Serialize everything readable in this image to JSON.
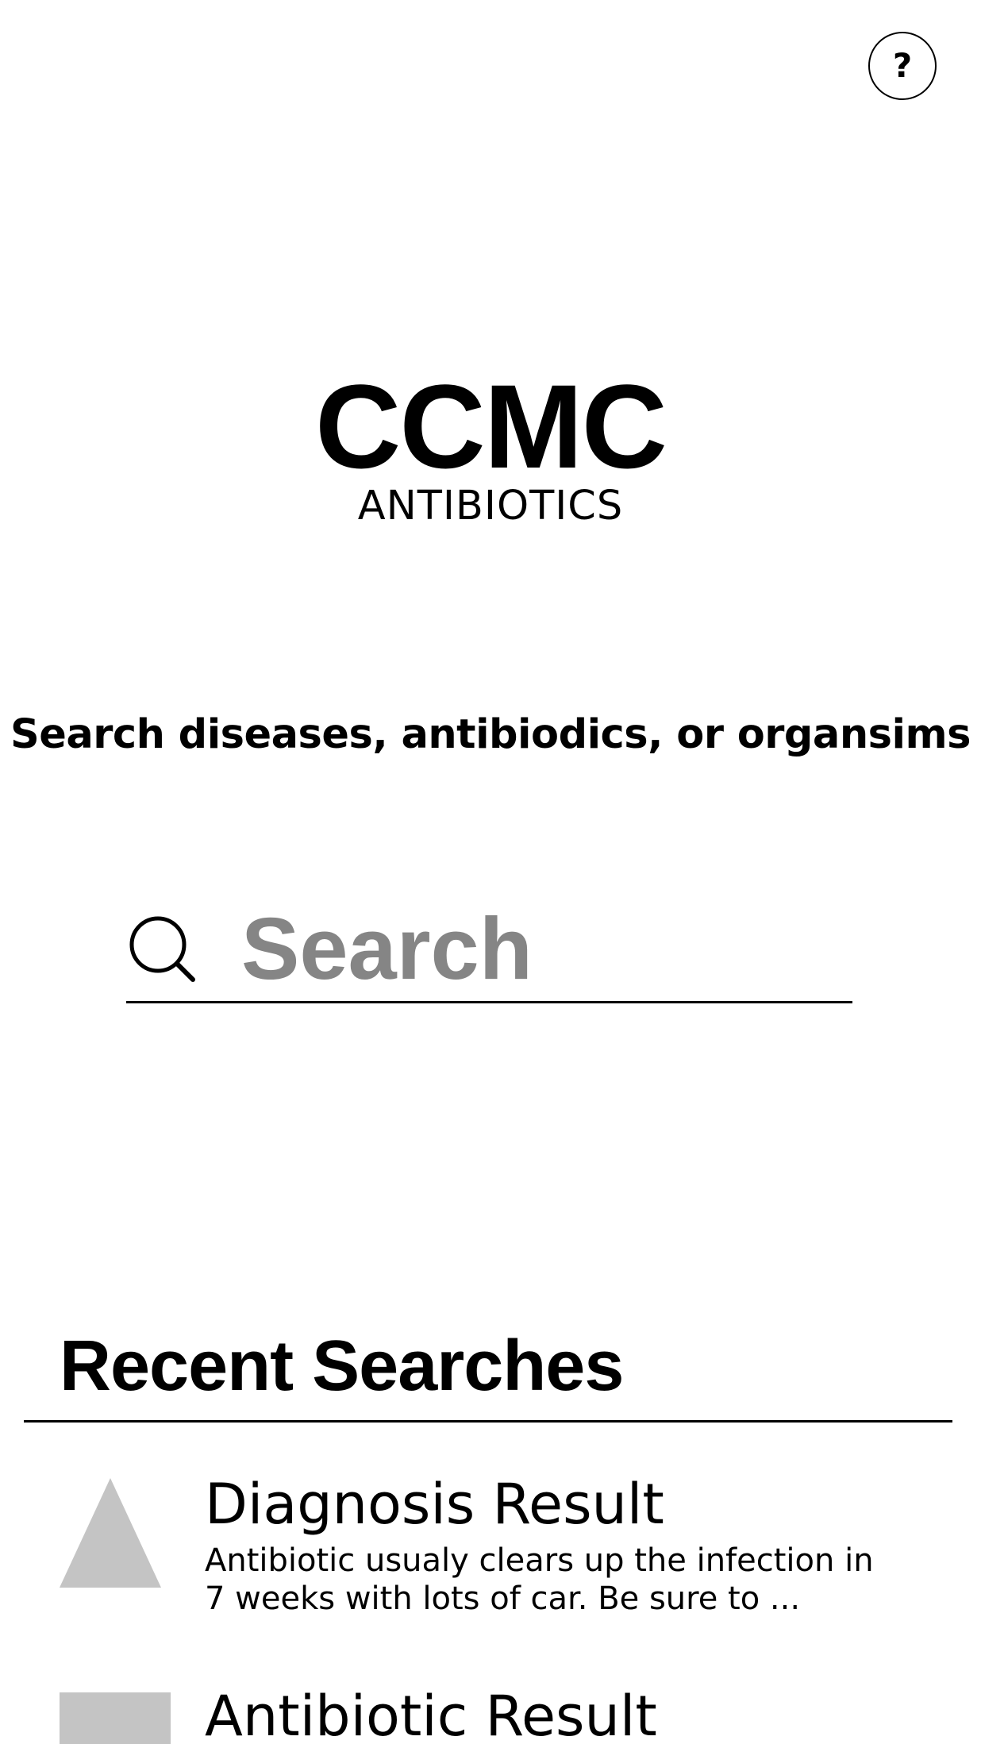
{
  "header": {
    "help_label": "?"
  },
  "brand": {
    "title": "CCMC",
    "subtitle": "ANTIBIOTICS"
  },
  "search": {
    "prompt": "Search diseases, antibiodics, or organsims",
    "placeholder": "Search",
    "value": "",
    "icon": "search-icon"
  },
  "recent": {
    "title": "Recent Searches",
    "items": [
      {
        "icon": "triangle-thumbnail-icon",
        "title": "Diagnosis Result",
        "description": "Antibiotic usualy clears up the infection in 7 weeks with lots of car. Be sure to ..."
      },
      {
        "icon": "square-thumbnail-icon",
        "title": "Antibiotic Result",
        "description": ""
      }
    ]
  },
  "colors": {
    "placeholder": "#858585",
    "thumbnail": "#c4c4c4",
    "text": "#000000",
    "background": "#ffffff"
  }
}
